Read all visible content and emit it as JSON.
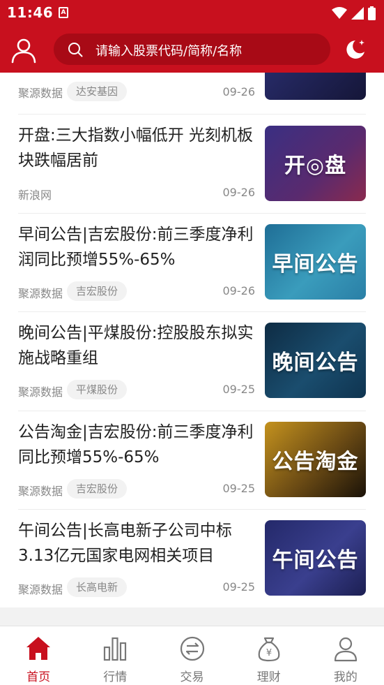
{
  "status_bar": {
    "time": "11:46",
    "app_icon": "A"
  },
  "header": {
    "search_placeholder": "请输入股票代码/简称/名称"
  },
  "news": [
    {
      "title": "",
      "source": "聚源数据",
      "tag": "达安基因",
      "date": "09-26",
      "thumb_text": "",
      "thumb_color": "#1c1f4d"
    },
    {
      "title": "开盘:三大指数小幅低开 光刻机板块跌幅居前",
      "source": "新浪网",
      "tag": "",
      "date": "09-26",
      "thumb_text": "开◎盘",
      "thumb_color": "#2d2868"
    },
    {
      "title": "早间公告|吉宏股份:前三季度净利润同比预增55%-65%",
      "source": "聚源数据",
      "tag": "吉宏股份",
      "date": "09-26",
      "thumb_text": "早间公告",
      "thumb_color": "#2a86a8"
    },
    {
      "title": "晚间公告|平煤股份:控股股东拟实施战略重组",
      "source": "聚源数据",
      "tag": "平煤股份",
      "date": "09-25",
      "thumb_text": "晚间公告",
      "thumb_color": "#123c5a"
    },
    {
      "title": "公告淘金|吉宏股份:前三季度净利同比预增55%-65%",
      "source": "聚源数据",
      "tag": "吉宏股份",
      "date": "09-25",
      "thumb_text": "公告淘金",
      "thumb_color": "#9a6a10"
    },
    {
      "title": "午间公告|长高电新子公司中标3.13亿元国家电网相关项目",
      "source": "聚源数据",
      "tag": "长高电新",
      "date": "09-25",
      "thumb_text": "午间公告",
      "thumb_color": "#2a2e6e"
    }
  ],
  "nav": [
    {
      "label": "首页",
      "icon": "home-icon",
      "active": true
    },
    {
      "label": "行情",
      "icon": "bar-chart-icon",
      "active": false
    },
    {
      "label": "交易",
      "icon": "exchange-icon",
      "active": false
    },
    {
      "label": "理财",
      "icon": "money-bag-icon",
      "active": false
    },
    {
      "label": "我的",
      "icon": "profile-icon",
      "active": false
    }
  ],
  "colors": {
    "brand": "#c8101e",
    "brand_dark": "#a80a16",
    "text": "#222222",
    "muted": "#888888"
  }
}
